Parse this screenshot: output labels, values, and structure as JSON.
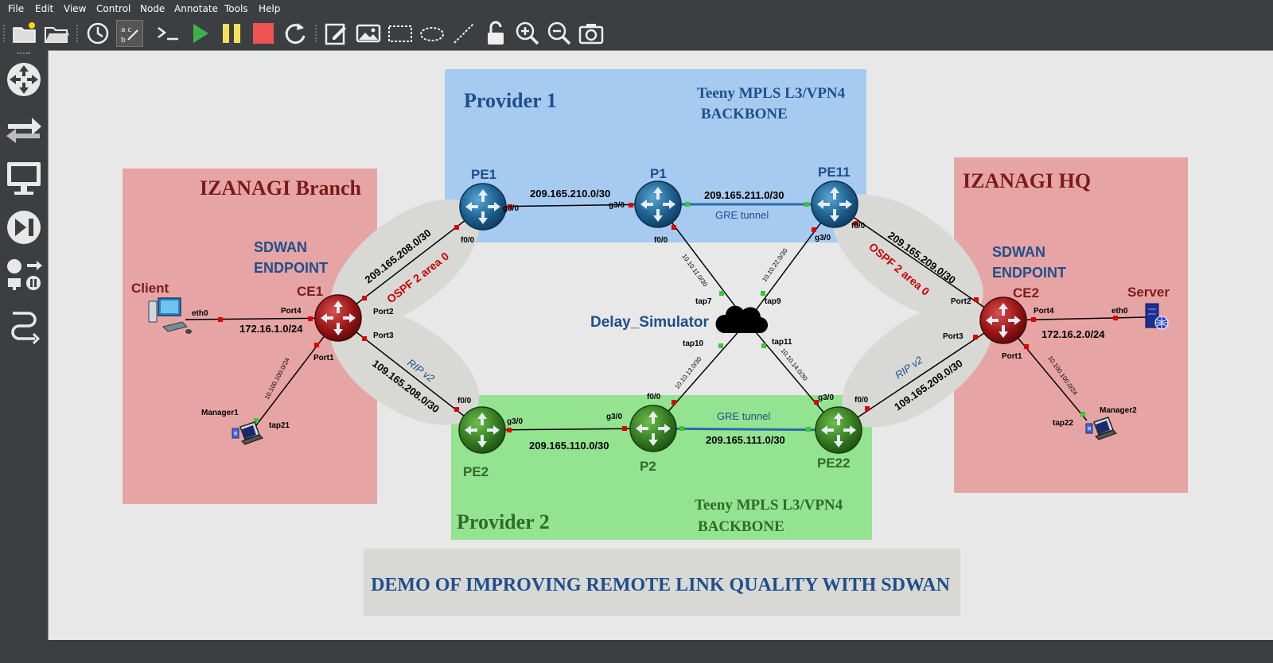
{
  "menu": {
    "file": "File",
    "edit": "Edit",
    "view": "View",
    "control": "Control",
    "node": "Node",
    "annotate": "Annotate",
    "tools": "Tools",
    "help": "Help"
  },
  "toolbar_icons": [
    "new-project-icon",
    "open-project-icon",
    "snapshot-icon",
    "show-labels-icon",
    "console-icon",
    "start-icon",
    "pause-icon",
    "stop-icon",
    "reload-icon",
    "add-note-icon",
    "insert-image-icon",
    "draw-rectangle-icon",
    "draw-ellipse-icon",
    "draw-line-icon",
    "lock-icon",
    "zoom-in-icon",
    "zoom-out-icon",
    "screenshot-icon"
  ],
  "left_icons": [
    "routers-icon",
    "switches-icon",
    "end-devices-icon",
    "security-devices-icon",
    "all-devices-icon",
    "add-link-icon"
  ],
  "colors": {
    "provider1_bg": "#a7cbf0",
    "provider2_bg": "#94e391",
    "site_bg": "#e6a5a4",
    "title_blue": "#1f4e8c",
    "title_dark_red": "#7a1a1a",
    "ospf_red": "#cc0000",
    "provider2_text": "#2e6b27",
    "canvas_bg": "#e8e8e8"
  },
  "zones": {
    "provider1": {
      "title": "Provider 1",
      "subtitle_line1": "Teeny MPLS L3/VPN4",
      "subtitle_line2": "BACKBONE"
    },
    "provider2": {
      "title": "Provider 2",
      "subtitle_line1": "Teeny MPLS L3/VPN4",
      "subtitle_line2": "BACKBONE"
    },
    "branch": {
      "title": "IZANAGI Branch",
      "sdwan_line1": "SDWAN",
      "sdwan_line2": "ENDPOINT"
    },
    "hq": {
      "title": "IZANAGI HQ",
      "sdwan_line1": "SDWAN",
      "sdwan_line2": "ENDPOINT"
    }
  },
  "banner": "DEMO OF IMPROVING REMOTE LINK QUALITY WITH SDWAN",
  "nodes": {
    "PE1": "PE1",
    "P1": "P1",
    "PE11": "PE11",
    "PE2": "PE2",
    "P2": "P2",
    "PE22": "PE22",
    "CE1": "CE1",
    "CE2": "CE2",
    "client": "Client",
    "server": "Server",
    "manager1": "Manager1",
    "manager2": "Manager2",
    "delay": "Delay_Simulator"
  },
  "links": {
    "pe1_p1_net": "209.165.210.0/30",
    "p1_pe11_net": "209.165.211.0/30",
    "gre_top": "GRE tunnel",
    "pe2_p2_net": "209.165.110.0/30",
    "p2_pe22_net": "209.165.111.0/30",
    "gre_bottom": "GRE tunnel",
    "ce1_pe1_net": "209.165.208.0/30",
    "ce1_pe2_net": "109.165.208.0/30",
    "ce2_pe11_net": "209.165.209.0/30",
    "ce2_pe22_net": "109.165.209.0/30",
    "ospf_left": "OSPF 2 area 0",
    "ospf_right": "OSPF 2 area 0",
    "rip_left": "RIP v2",
    "rip_right": "RIP v2",
    "client_net": "172.16.1.0/24",
    "server_net": "172.16.2.0/24",
    "mgr1_net": "10.100.100.0/24",
    "mgr2_net": "10.100.100.0/24",
    "ds_p1": "10.10.11.0/30",
    "ds_pe11": "10.10.22.0/30",
    "ds_p2": "10.10.13.0/30",
    "ds_pe22": "10.10.14.0/30"
  },
  "ports": {
    "pe1_g30": "g3/0",
    "pe1_f00": "f0/0",
    "p1_g30": "g3/0",
    "p1_f00": "f0/0",
    "pe11_f00": "f0/0",
    "pe11_g30": "g3/0",
    "pe2_f00": "f0/0",
    "pe2_g30": "g3/0",
    "p2_g30": "g3/0",
    "p2_f00": "f0/0",
    "pe22_g30": "g3/0",
    "pe22_f00": "f0/0",
    "ce1_port4": "Port4",
    "ce1_port2": "Port2",
    "ce1_port3": "Port3",
    "ce1_port1": "Port1",
    "ce2_port2": "Port2",
    "ce2_port4": "Port4",
    "ce2_port3": "Port3",
    "ce2_port1": "Port1",
    "client_eth0": "eth0",
    "server_eth0": "eth0",
    "tap7": "tap7",
    "tap9": "tap9",
    "tap10": "tap10",
    "tap11": "tap11",
    "tap21": "tap21",
    "tap22": "tap22"
  }
}
